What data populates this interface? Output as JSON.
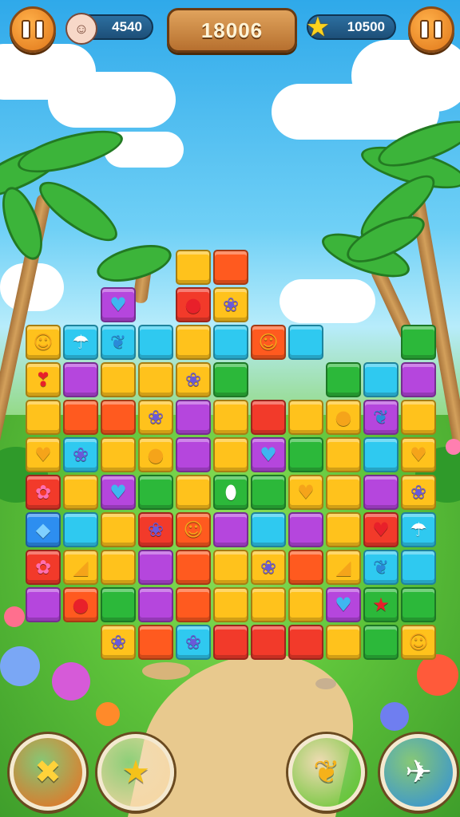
{
  "hud": {
    "pause_left_label": "II",
    "coins_value": "4540",
    "score_value": "18006",
    "stars_value": "10500",
    "pause_right_label": "II"
  },
  "colors": {
    "yellow": "#ffc21c",
    "orange": "#ff5a1f",
    "red": "#f23a2a",
    "purple": "#b546dd",
    "cyan": "#2fc9f0",
    "green": "#2cb83a",
    "blue": "#2d8ef0"
  },
  "board": {
    "rows": [
      [
        null,
        null,
        null,
        null,
        [
          "yellow",
          ""
        ],
        [
          "orange",
          ""
        ],
        null,
        null,
        null,
        null,
        null,
        null
      ],
      [
        null,
        null,
        [
          "purple",
          "heart"
        ],
        null,
        [
          "red",
          "apple"
        ],
        [
          "yellow",
          "critter"
        ],
        null,
        null,
        null,
        null,
        null,
        null
      ],
      [
        [
          "yellow",
          "smiley"
        ],
        [
          "cyan",
          "mushroom"
        ],
        [
          "cyan",
          "bird"
        ],
        [
          "cyan",
          ""
        ],
        [
          "yellow",
          ""
        ],
        [
          "cyan",
          ""
        ],
        [
          "orange",
          "smiley"
        ],
        [
          "cyan",
          ""
        ],
        null,
        null,
        [
          "green",
          ""
        ],
        null
      ],
      [
        [
          "yellow",
          "pepper"
        ],
        [
          "purple",
          ""
        ],
        [
          "yellow",
          ""
        ],
        [
          "yellow",
          ""
        ],
        [
          "yellow",
          "critter"
        ],
        [
          "green",
          ""
        ],
        null,
        null,
        [
          "green",
          ""
        ],
        [
          "cyan",
          ""
        ],
        [
          "purple",
          ""
        ],
        null
      ],
      [
        [
          "yellow",
          ""
        ],
        [
          "orange",
          ""
        ],
        [
          "orange",
          ""
        ],
        [
          "yellow",
          "critter"
        ],
        [
          "purple",
          ""
        ],
        [
          "yellow",
          ""
        ],
        [
          "red",
          ""
        ],
        [
          "yellow",
          ""
        ],
        [
          "yellow",
          "lemon"
        ],
        [
          "purple",
          "bird"
        ],
        [
          "yellow",
          ""
        ],
        null
      ],
      [
        [
          "yellow",
          "heart"
        ],
        [
          "cyan",
          "critter"
        ],
        [
          "yellow",
          ""
        ],
        [
          "yellow",
          "lemon"
        ],
        [
          "purple",
          ""
        ],
        [
          "yellow",
          ""
        ],
        [
          "purple",
          "heart"
        ],
        [
          "green",
          ""
        ],
        [
          "yellow",
          ""
        ],
        [
          "cyan",
          ""
        ],
        [
          "yellow",
          "heart"
        ],
        null
      ],
      [
        [
          "red",
          "flower"
        ],
        [
          "yellow",
          ""
        ],
        [
          "purple",
          "heart"
        ],
        [
          "green",
          ""
        ],
        [
          "yellow",
          ""
        ],
        [
          "green",
          "egg"
        ],
        [
          "green",
          ""
        ],
        [
          "yellow",
          "heart"
        ],
        [
          "yellow",
          ""
        ],
        [
          "purple",
          ""
        ],
        [
          "yellow",
          "critter"
        ],
        null
      ],
      [
        [
          "blue",
          "fish"
        ],
        [
          "cyan",
          ""
        ],
        [
          "yellow",
          ""
        ],
        [
          "red",
          "critter"
        ],
        [
          "orange",
          "smiley"
        ],
        [
          "purple",
          ""
        ],
        [
          "cyan",
          ""
        ],
        [
          "purple",
          ""
        ],
        [
          "yellow",
          ""
        ],
        [
          "red",
          "heart"
        ],
        [
          "cyan",
          "mushroom"
        ],
        null
      ],
      [
        [
          "red",
          "flower"
        ],
        [
          "yellow",
          "cheese"
        ],
        [
          "yellow",
          ""
        ],
        [
          "purple",
          ""
        ],
        [
          "orange",
          ""
        ],
        [
          "yellow",
          ""
        ],
        [
          "yellow",
          "critter"
        ],
        [
          "orange",
          ""
        ],
        [
          "yellow",
          "cheese"
        ],
        [
          "cyan",
          "bird"
        ],
        [
          "cyan",
          ""
        ],
        null
      ],
      [
        [
          "purple",
          ""
        ],
        [
          "orange",
          "apple"
        ],
        [
          "green",
          ""
        ],
        [
          "purple",
          ""
        ],
        [
          "orange",
          ""
        ],
        [
          "yellow",
          ""
        ],
        [
          "yellow",
          ""
        ],
        [
          "yellow",
          ""
        ],
        [
          "purple",
          "heart"
        ],
        [
          "green",
          "star"
        ],
        [
          "green",
          ""
        ],
        null
      ],
      [
        null,
        null,
        [
          "yellow",
          "critter"
        ],
        [
          "orange",
          ""
        ],
        [
          "cyan",
          "critter"
        ],
        [
          "red",
          ""
        ],
        [
          "red",
          ""
        ],
        [
          "red",
          ""
        ],
        [
          "yellow",
          ""
        ],
        [
          "green",
          ""
        ],
        [
          "yellow",
          "smiley"
        ],
        null
      ]
    ]
  },
  "icons": {
    "heart": "♥",
    "apple": "●",
    "critter": "❀",
    "smiley": "☺",
    "mushroom": "☂",
    "bird": "❦",
    "pepper": "❣",
    "lemon": "●",
    "flower": "✿",
    "egg": "⬮",
    "fish": "◆",
    "cheese": "◢",
    "star": "★"
  },
  "bottom_buttons": [
    {
      "name": "shuffle-booster-button",
      "icon": "✖",
      "color": "#f06a1c"
    },
    {
      "name": "star-booster-button",
      "icon": "★",
      "color": "#f7d7a2"
    },
    {
      "name": "bird-booster-button",
      "icon": "❦",
      "color": "#5fc42a"
    },
    {
      "name": "rocket-booster-button",
      "icon": "✈",
      "color": "#2f8fe0"
    }
  ]
}
